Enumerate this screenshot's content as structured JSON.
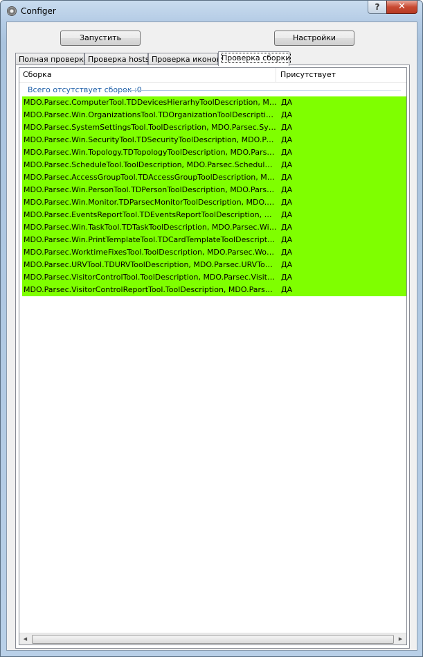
{
  "window": {
    "title": "Configer",
    "help_label": "?",
    "close_label": "✕"
  },
  "toolbar": {
    "run_label": "Запустить",
    "settings_label": "Настройки"
  },
  "tabs": [
    {
      "label": "Полная проверка"
    },
    {
      "label": "Проверка hosts"
    },
    {
      "label": "Проверка иконок"
    },
    {
      "label": "Проверка сборки"
    }
  ],
  "active_tab": "Проверка сборки",
  "list": {
    "columns": [
      "Сборка",
      "Присутствует"
    ],
    "group_label": "Всего отсутствует сборок :0",
    "row_color": "#7fff00",
    "rows": [
      {
        "assembly": "MDO.Parsec.ComputerTool.TDDevicesHierarhyToolDescription, MDO.Parsec.ComputerTool",
        "present": "ДА"
      },
      {
        "assembly": "MDO.Parsec.Win.OrganizationsTool.TDOrganizationToolDescription, MDO.Parsec.Win.OrganizationsTool",
        "present": "ДА"
      },
      {
        "assembly": "MDO.Parsec.SystemSettingsTool.ToolDescription, MDO.Parsec.SystemSettingsTool",
        "present": "ДА"
      },
      {
        "assembly": "MDO.Parsec.Win.SecurityTool.TDSecurityToolDescription, MDO.Parsec.Win.SecurityTool",
        "present": "ДА"
      },
      {
        "assembly": "MDO.Parsec.Win.Topology.TDTopologyToolDescription, MDO.Parsec.Topology",
        "present": "ДА"
      },
      {
        "assembly": "MDO.Parsec.ScheduleTool.ToolDescription, MDO.Parsec.ScheduleTool, Version",
        "present": "ДА"
      },
      {
        "assembly": "MDO.Parsec.AccessGroupTool.TDAccessGroupToolDescription, MDO.Parsec.AccessGroupTool",
        "present": "ДА"
      },
      {
        "assembly": "MDO.Parsec.Win.PersonTool.TDPersonToolDescription, MDO.Parsec.Win.PersonTool",
        "present": "ДА"
      },
      {
        "assembly": "MDO.Parsec.Win.Monitor.TDParsecMonitorToolDescription, MDO.Parsec.Monitor",
        "present": "ДА"
      },
      {
        "assembly": "MDO.Parsec.EventsReportTool.TDEventsReportToolDescription, MDO.Parsec.EventsReportTool",
        "present": "ДА"
      },
      {
        "assembly": "MDO.Parsec.Win.TaskTool.TDTaskToolDescription, MDO.Parsec.Win.TaskTool",
        "present": "ДА"
      },
      {
        "assembly": "MDO.Parsec.Win.PrintTemplateTool.TDCardTemplateToolDescription, MDO.Parsec",
        "present": "ДА"
      },
      {
        "assembly": "MDO.Parsec.WorktimeFixesTool.ToolDescription, MDO.Parsec.WorktimeFixesTool",
        "present": "ДА"
      },
      {
        "assembly": "MDO.Parsec.URVTool.TDURVToolDescription, MDO.Parsec.URVTool, Version",
        "present": "ДА"
      },
      {
        "assembly": "MDO.Parsec.VisitorControlTool.ToolDescription, MDO.Parsec.VisitorControlTool",
        "present": "ДА"
      },
      {
        "assembly": "MDO.Parsec.VisitorControlReportTool.ToolDescription, MDO.Parsec.VisitorControlReportTool",
        "present": "ДА"
      }
    ]
  }
}
